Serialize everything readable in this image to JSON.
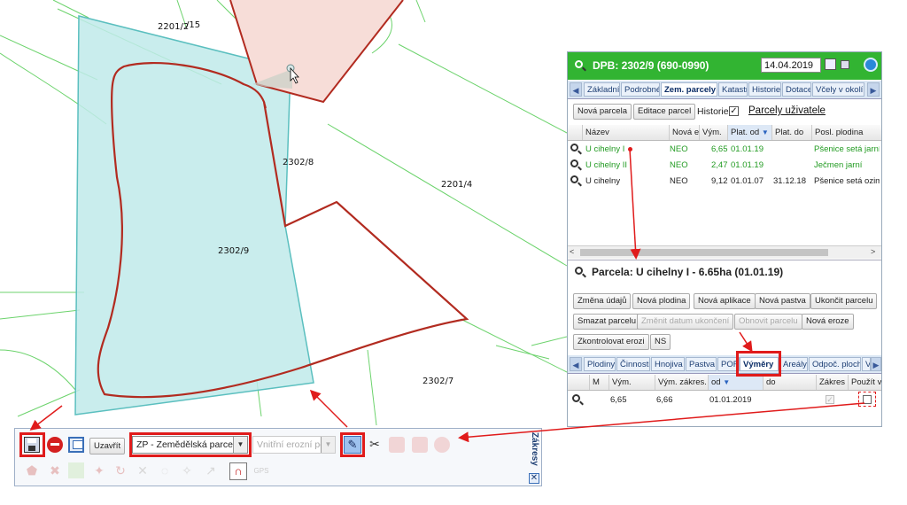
{
  "map": {
    "labels": [
      "2201/2",
      "/15",
      "2302/8",
      "2201/4",
      "2302/9",
      "2302/7"
    ]
  },
  "panel": {
    "title": "DPB: 2302/9 (690-0990)",
    "date": "14.04.2019",
    "tabs": [
      "Základní",
      "Podrobné",
      "Zem. parcely",
      "Katastr",
      "Historie",
      "Dotace",
      "Včely v okolí"
    ],
    "buttons": {
      "new_parcel": "Nová parcela",
      "edit_parcel": "Editace parcel",
      "history_label": "Historie",
      "users_link": "Parcely uživatele"
    },
    "grid": {
      "columns": [
        "Název",
        "Nová e",
        "Vým.",
        "Plat. od",
        "Plat. do",
        "Posl. plodina"
      ],
      "rows": [
        {
          "name": "U cihelny I",
          "new": "NEO",
          "area": "6,65",
          "from": "01.01.19",
          "to": "",
          "crop": "Pšenice setá jarní",
          "green": true
        },
        {
          "name": "U cihelny II",
          "new": "NEO",
          "area": "2,47",
          "from": "01.01.19",
          "to": "",
          "crop": "Ječmen jarní",
          "green": true
        },
        {
          "name": "U cihelny",
          "new": "NEO",
          "area": "9,12",
          "from": "01.01.07",
          "to": "31.12.18",
          "crop": "Pšenice setá ozimá",
          "green": false
        }
      ]
    },
    "parcel": {
      "title": "Parcela: U cihelny I - 6.65ha (01.01.19)",
      "actions": [
        "Změna údajů",
        "Nová plodina",
        "Nová aplikace",
        "Nová pastva",
        "Ukončit parcelu",
        "Smazat parcelu",
        "Změnit datum ukončení",
        "Obnovit parcelu",
        "Nová eroze",
        "Zkontrolovat erozi",
        "NS"
      ],
      "subtabs": [
        "Plodiny",
        "Činnosti",
        "Hnojiva",
        "Pastva",
        "POR",
        "Výměry",
        "Areály",
        "Odpoč. ploch",
        "V"
      ],
      "subgrid": {
        "columns": [
          "M",
          "Vým.",
          "Vým. zákres.",
          "od",
          "do",
          "Zákres",
          "Použít vý"
        ],
        "row": {
          "area": "6,65",
          "drawn": "6,66",
          "from": "01.01.2019"
        }
      }
    }
  },
  "toolbar": {
    "title": "Zákresy",
    "close_button": "Uzavřít",
    "layer_select": "ZP - Zemědělská parcela",
    "erosion_select": "Vnitřní erozní poze",
    "gps_label": "GPS"
  },
  "colors": {
    "header_green": "#32b432",
    "highlight_red": "#e01b1b",
    "parcel_red": "#b22b20",
    "cadastre_green": "#6cd36c",
    "selection_cyan": "#bfeaea"
  }
}
